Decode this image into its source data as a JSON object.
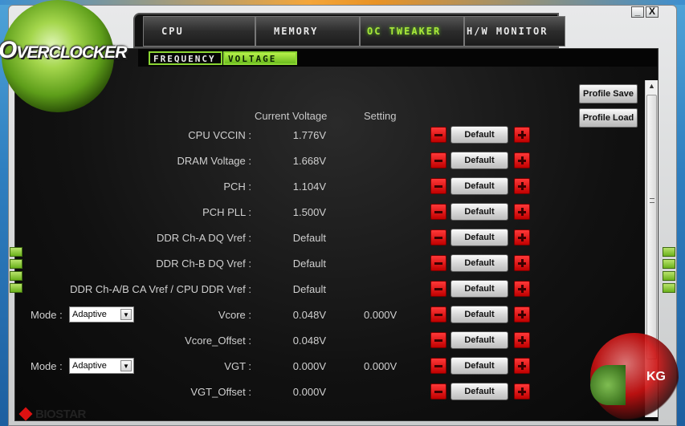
{
  "app": {
    "logo_text_lead": "O",
    "logo_text": "VERCLOCKER",
    "minimize_label": "_",
    "close_label": "X"
  },
  "tabs": [
    {
      "label": "CPU",
      "active": false
    },
    {
      "label": "MEMORY",
      "active": false
    },
    {
      "label": "OC TWEAKER",
      "active": true
    },
    {
      "label": "H/W MONITOR",
      "active": false
    }
  ],
  "subtabs": [
    {
      "label": "FREQUENCY",
      "active": false
    },
    {
      "label": "VOLTAGE",
      "active": true
    }
  ],
  "headers": {
    "current": "Current Voltage",
    "setting": "Setting"
  },
  "rows": [
    {
      "label": "CPU VCCIN :",
      "current": "1.776V",
      "setting": "",
      "button": "Default"
    },
    {
      "label": "DRAM Voltage :",
      "current": "1.668V",
      "setting": "",
      "button": "Default"
    },
    {
      "label": "PCH :",
      "current": "1.104V",
      "setting": "",
      "button": "Default"
    },
    {
      "label": "PCH PLL :",
      "current": "1.500V",
      "setting": "",
      "button": "Default"
    },
    {
      "label": "DDR Ch-A DQ Vref :",
      "current": "Default",
      "setting": "",
      "button": "Default"
    },
    {
      "label": "DDR Ch-B DQ Vref :",
      "current": "Default",
      "setting": "",
      "button": "Default"
    },
    {
      "label": "DDR Ch-A/B CA Vref / CPU DDR Vref :",
      "current": "Default",
      "setting": "",
      "button": "Default"
    },
    {
      "label": "Vcore :",
      "current": "0.048V",
      "setting": "0.000V",
      "button": "Default",
      "mode_label": "Mode :",
      "mode_value": "Adaptive"
    },
    {
      "label": "Vcore_Offset :",
      "current": "0.048V",
      "setting": "",
      "button": "Default"
    },
    {
      "label": "VGT :",
      "current": "0.000V",
      "setting": "0.000V",
      "button": "Default",
      "mode_label": "Mode :",
      "mode_value": "Adaptive"
    },
    {
      "label": "VGT_Offset :",
      "current": "0.000V",
      "setting": "",
      "button": "Default"
    }
  ],
  "profile": {
    "save_label": "Profile Save",
    "load_label": "Profile Load"
  },
  "branding": {
    "vendor": "BIOSTAR",
    "watermark": "KG"
  },
  "colors": {
    "accent_green": "#8bd633",
    "button_red": "#e01010"
  }
}
